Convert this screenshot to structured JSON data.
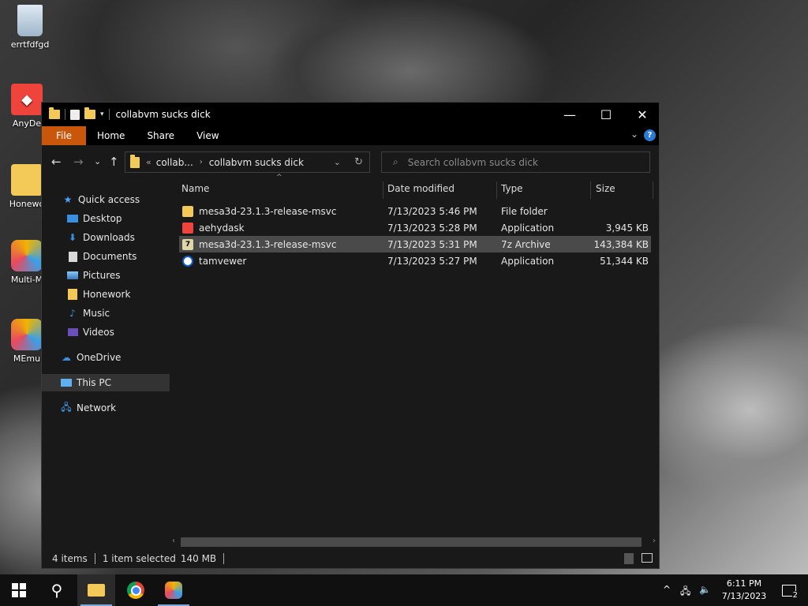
{
  "desktop": {
    "icons": [
      {
        "label": "errtfdfgd",
        "name": "recycle-bin"
      },
      {
        "label": "AnyDe",
        "name": "anydesk"
      },
      {
        "label": "Honewo",
        "name": "honework-folder"
      },
      {
        "label": "Multi-M",
        "name": "multi-instance"
      },
      {
        "label": "MEmu",
        "name": "memu"
      }
    ]
  },
  "window": {
    "title": "collabvm sucks dick",
    "ribbon_tabs": [
      "File",
      "Home",
      "Share",
      "View"
    ],
    "help": "?",
    "address": {
      "crumb_collapsed": "collab...",
      "crumb_current": "collabvm sucks dick"
    },
    "search_placeholder": "Search collabvm sucks dick"
  },
  "nav_pane": {
    "items": [
      {
        "label": "Quick access",
        "icon": "star-icon",
        "pinned": false
      },
      {
        "label": "Desktop",
        "icon": "desktop-icon",
        "pinned": true
      },
      {
        "label": "Downloads",
        "icon": "download-icon",
        "pinned": true
      },
      {
        "label": "Documents",
        "icon": "document-icon",
        "pinned": true
      },
      {
        "label": "Pictures",
        "icon": "picture-icon",
        "pinned": true
      },
      {
        "label": "Honework",
        "icon": "folder-icon",
        "pinned": false
      },
      {
        "label": "Music",
        "icon": "music-icon",
        "pinned": false
      },
      {
        "label": "Videos",
        "icon": "video-icon",
        "pinned": false
      },
      {
        "label": "OneDrive",
        "icon": "cloud-icon",
        "pinned": false
      },
      {
        "label": "This PC",
        "icon": "computer-icon",
        "pinned": false
      },
      {
        "label": "Network",
        "icon": "network-icon",
        "pinned": false
      }
    ]
  },
  "file_list": {
    "columns": [
      "Name",
      "Date modified",
      "Type",
      "Size"
    ],
    "rows": [
      {
        "name": "mesa3d-23.1.3-release-msvc",
        "date": "7/13/2023 5:46 PM",
        "type": "File folder",
        "size": "",
        "icon": "folder-icon"
      },
      {
        "name": "aehydask",
        "date": "7/13/2023 5:28 PM",
        "type": "Application",
        "size": "3,945 KB",
        "icon": "anydesk-icon"
      },
      {
        "name": "mesa3d-23.1.3-release-msvc",
        "date": "7/13/2023 5:31 PM",
        "type": "7z Archive",
        "size": "143,384 KB",
        "icon": "7z-archive-icon"
      },
      {
        "name": "tamvewer",
        "date": "7/13/2023 5:27 PM",
        "type": "Application",
        "size": "51,344 KB",
        "icon": "teamviewer-icon"
      }
    ]
  },
  "status": {
    "items": "4 items",
    "selected": "1 item selected",
    "size": "140 MB"
  },
  "taskbar": {
    "clock_time": "6:11 PM",
    "clock_date": "7/13/2023",
    "notifications": "2"
  },
  "colors": {
    "file_tab": "#c8570c",
    "accent": "#2a7ad6",
    "folder": "#f3c957"
  }
}
